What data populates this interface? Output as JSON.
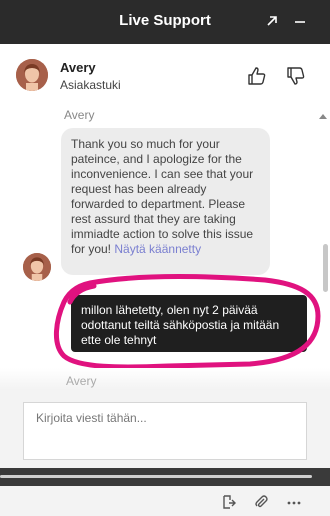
{
  "window": {
    "title": "Live Support",
    "popout_icon": "popout-arrow-icon",
    "minimize_icon": "minimize-icon"
  },
  "agent": {
    "name": "Avery",
    "subtitle": "Asiakastuki",
    "thumbs_up_icon": "thumbs-up-icon",
    "thumbs_down_icon": "thumbs-down-icon"
  },
  "chat": {
    "messages": [
      {
        "sender": "Avery",
        "text": "Thank you so much for your pateince, and I apologize for the inconvenience. I can see that your request has been already forwarded to department. Please rest assurd that they are taking immiadte action to solve this issue for you!",
        "translate_link": "Näytä käännetty"
      }
    ],
    "next_sender": "Avery",
    "tooltip_text": "millon lähetetty, olen nyt 2 päivää odottanut teiltä sähköpostia ja mitään ette ole tehnyt"
  },
  "composer": {
    "placeholder": "Kirjoita viesti tähän...",
    "icons": [
      "send-file-icon",
      "attachment-icon",
      "more-icon"
    ]
  },
  "colors": {
    "titlebar": "#2b2b2b",
    "bubble": "#ececec",
    "annotation": "#e0127f",
    "tooltip": "#1f1f1f"
  }
}
